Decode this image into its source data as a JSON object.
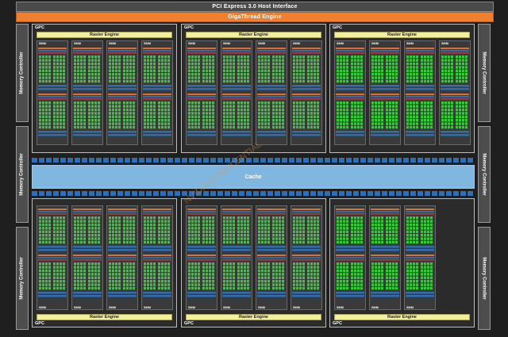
{
  "header": {
    "pcie_label": "PCI Express 3.0 Host Interface",
    "gigathread_label": "GigaThread Engine"
  },
  "memory_controller_label": "Memory Controller",
  "gpc_label": "GPC",
  "raster_engine_label": "Raster Engine",
  "smm_label": "SMM",
  "cache_label": "Cache",
  "watermark": "NVIDIA CONFIDENTIAL",
  "colors": {
    "pcie": "#4a4a4a",
    "gigathread": "#f08030",
    "raster": "#f4f09a",
    "cache": "#7fb7e0",
    "core": "#39c93c",
    "blue_unit": "#2c6fb5"
  }
}
